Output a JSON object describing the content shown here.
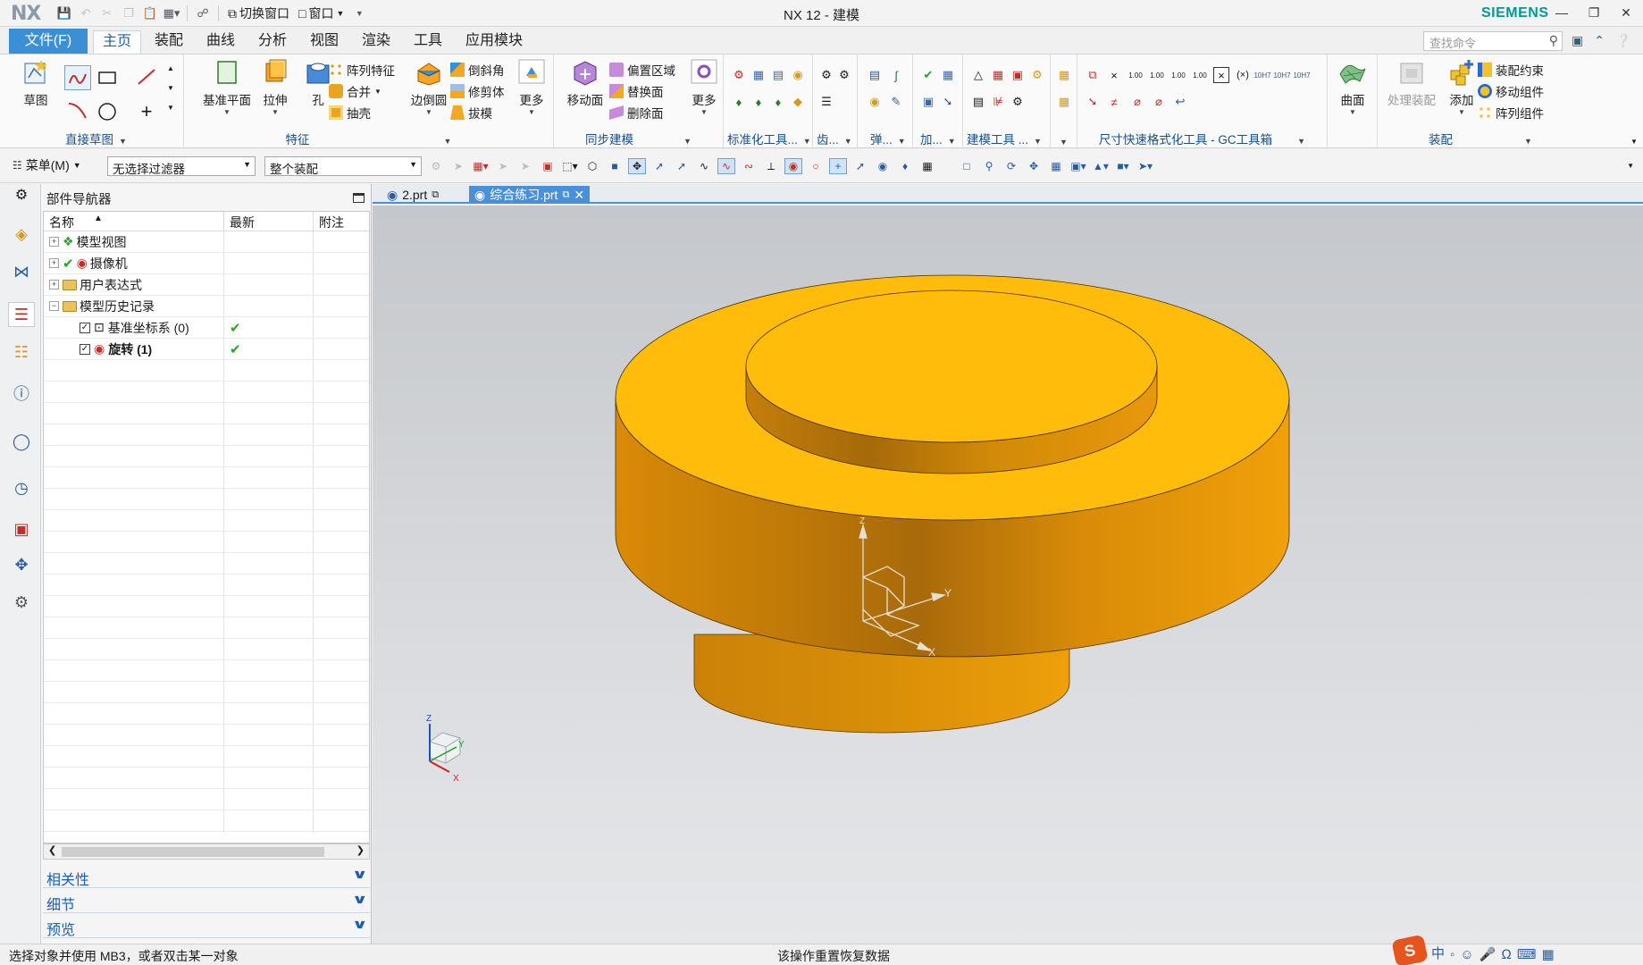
{
  "titlebar": {
    "logo": "NX",
    "switch_window": "切换窗口",
    "window_menu": "窗口",
    "title": "NX 12 - 建模",
    "brand": "SIEMENS"
  },
  "tabs": {
    "file": "文件(F)",
    "home": "主页",
    "assembly": "装配",
    "curve": "曲线",
    "analysis": "分析",
    "view": "视图",
    "render": "渲染",
    "tools": "工具",
    "app_module": "应用模块"
  },
  "search": {
    "placeholder": "查找命令"
  },
  "ribbon": {
    "sketch": "草图",
    "direct_sketch": "直接草图",
    "datum_plane": "基准平面",
    "extrude": "拉伸",
    "hole": "孔",
    "pattern_feature": "阵列特征",
    "unite": "合并",
    "shell": "抽壳",
    "edge_blend": "边倒圆",
    "chamfer": "倒斜角",
    "trim_body": "修剪体",
    "draft": "拔模",
    "more": "更多",
    "feature": "特征",
    "move_face": "移动面",
    "offset_region": "偏置区域",
    "replace_face": "替换面",
    "delete_face": "删除面",
    "more2": "更多",
    "sync_modeling": "同步建模",
    "std_tools": "标准化工具...",
    "gear": "齿...",
    "spring": "弹...",
    "process": "加...",
    "modeling_tools": "建模工具 ...",
    "dim_tools": "尺寸快速格式化工具 - GC工具箱",
    "surface": "曲面",
    "process_assembly": "处理装配",
    "add": "添加",
    "assembly_constraint": "装配约束",
    "move_component": "移动组件",
    "pattern_component": "阵列组件",
    "assembly_group": "装配"
  },
  "cmdbar": {
    "menu": "菜单(M)",
    "filter": "无选择过滤器",
    "scope": "整个装配"
  },
  "navigator": {
    "title": "部件导航器",
    "col_name": "名称",
    "col_latest": "最新",
    "col_note": "附注",
    "rows": [
      {
        "label": "模型视图"
      },
      {
        "label": "摄像机"
      },
      {
        "label": "用户表达式"
      },
      {
        "label": "模型历史记录"
      },
      {
        "label": "基准坐标系 (0)"
      },
      {
        "label": "旋转 (1)"
      }
    ],
    "panels": [
      "相关性",
      "细节",
      "预览"
    ]
  },
  "doctabs": [
    "2.prt",
    "综合练习.prt"
  ],
  "axes": {
    "z": "Z",
    "y": "Y",
    "x": "X"
  },
  "status": {
    "left": "选择对象并使用 MB3，或者双击某一对象",
    "center": "该操作重置恢复数据"
  },
  "colors": {
    "part_top": "#FFBC0A",
    "part_side": "#E89A0C",
    "accent": "#3B8FD4",
    "brand": "#009999"
  }
}
